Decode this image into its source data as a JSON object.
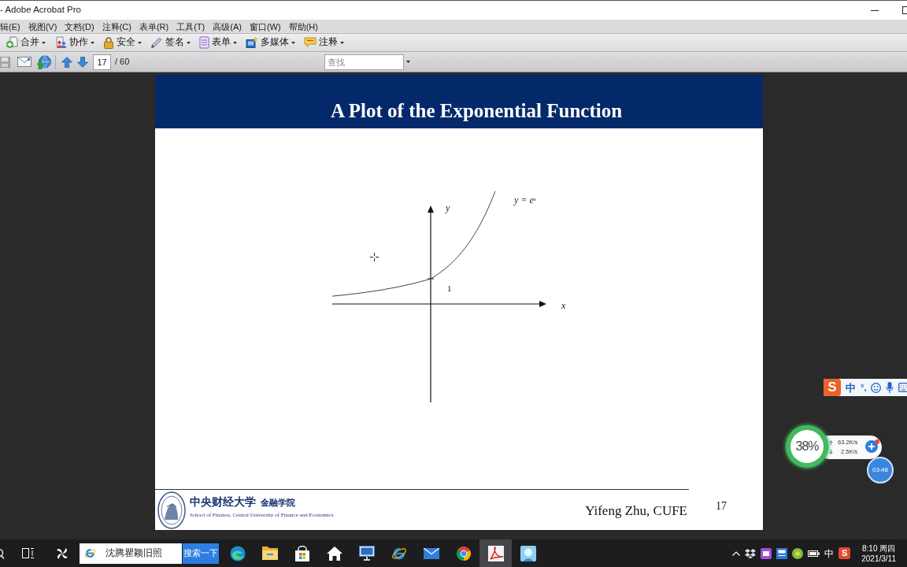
{
  "window": {
    "title": "- Adobe Acrobat Pro"
  },
  "menu_bar": {
    "items": [
      "辑(E)",
      "视图(V)",
      "文档(D)",
      "注释(C)",
      "表单(R)",
      "工具(T)",
      "高级(A)",
      "窗口(W)",
      "帮助(H)"
    ]
  },
  "task_toolbar": {
    "buttons": [
      {
        "label": "合并"
      },
      {
        "label": "协作"
      },
      {
        "label": "安全"
      },
      {
        "label": "签名"
      },
      {
        "label": "表单"
      },
      {
        "label": "多媒体"
      },
      {
        "label": "注释"
      }
    ]
  },
  "page_toolbar": {
    "buttons": [
      {
        "disabled": true
      },
      {
        "disabled": false
      },
      {
        "disabled": false
      },
      {
        "disabled": false
      },
      {
        "disabled": false
      }
    ],
    "page_field": {
      "value": "17"
    },
    "page_count": "/ 60",
    "find_field": {
      "placeholder": "查找"
    }
  },
  "slide": {
    "title": "A Plot of the Exponential Function",
    "figure": {
      "y_axis_label": "y",
      "x_axis_label": "x",
      "intercept_label": "1",
      "curve_label": "y = e$^{x}$"
    },
    "footer": {
      "school_name": "中央财经大学",
      "college_name": "金融学院",
      "school_english": "School of Finance, Central University of Finance and Economics",
      "author": "Yifeng Zhu, CUFE",
      "page_number": "17"
    }
  },
  "ime_toolbar": {
    "logo": "S",
    "mode": "中",
    "punctuation": "°,"
  },
  "network_monitor": {
    "usage": "38%",
    "upload": "63.2K/s",
    "download": "2.5K/s",
    "timer": "03:48"
  },
  "taskbar": {
    "search_field": {
      "value": "沈腾瞿颖旧照"
    },
    "search_button": "搜索一下",
    "apps": [
      {
        "selected": false
      },
      {
        "selected": false
      },
      {
        "selected": false
      },
      {
        "selected": false
      },
      {
        "selected": false
      },
      {
        "selected": false
      },
      {
        "selected": false
      },
      {
        "selected": false
      },
      {
        "selected": true
      },
      {
        "selected": false
      }
    ],
    "tray": {
      "ime": "中",
      "ime_logo": "S",
      "time": "8:10 周四",
      "date": "2021/3/11"
    }
  }
}
